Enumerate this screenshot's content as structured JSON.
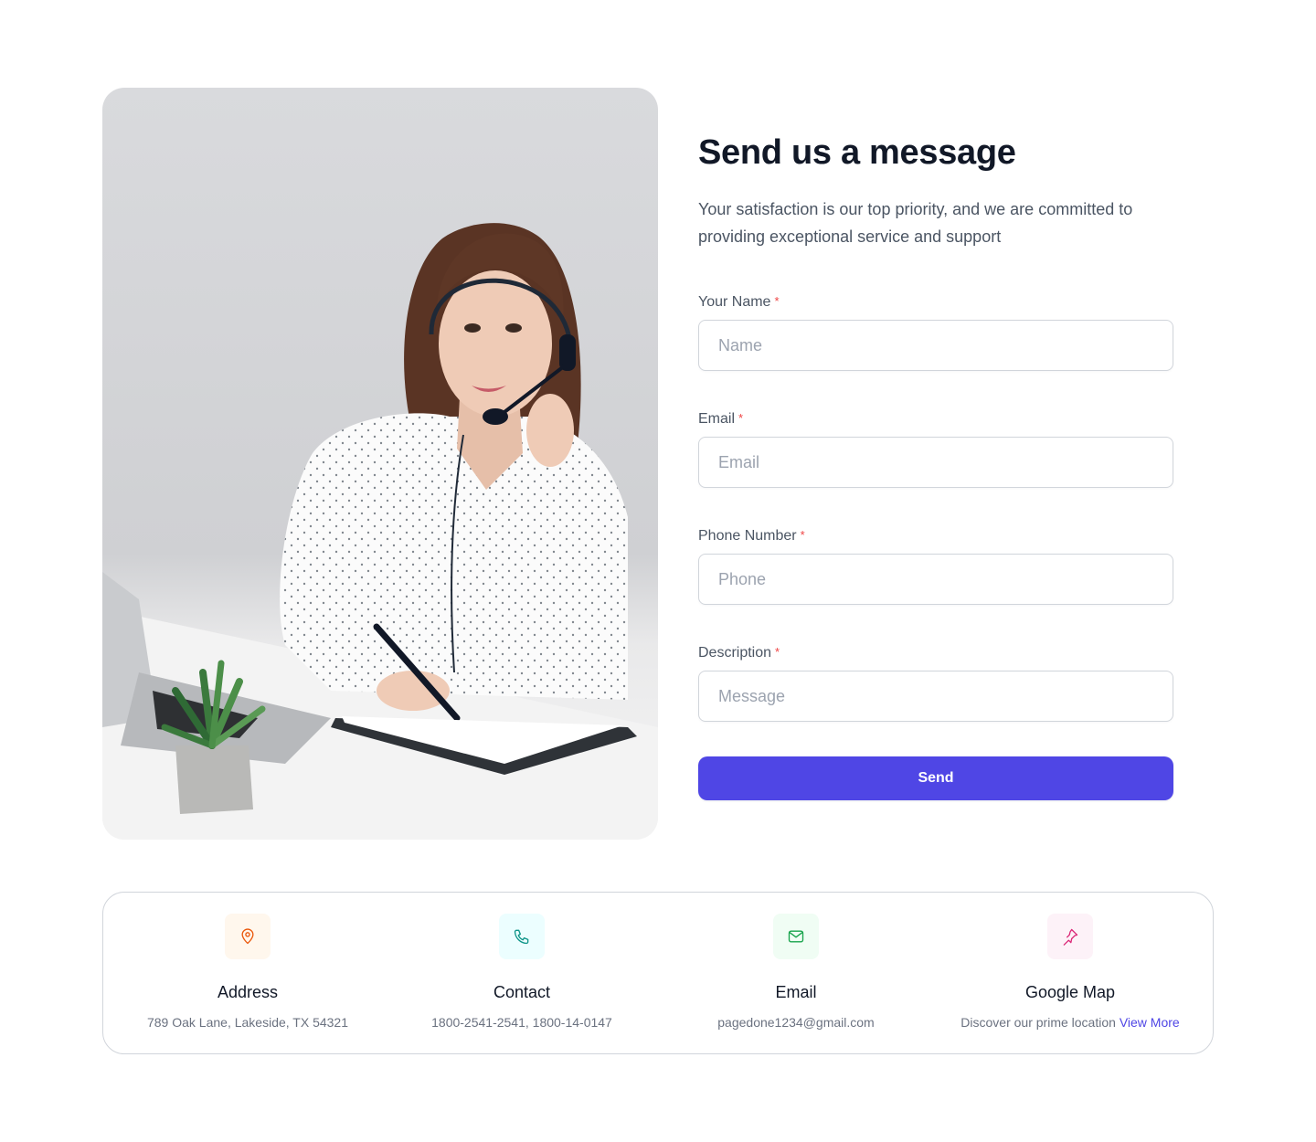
{
  "form": {
    "title": "Send us a message",
    "subtitle": "Your satisfaction is our top priority, and we are committed to providing exceptional service and support",
    "required_mark": "*",
    "fields": [
      {
        "label": "Your Name",
        "placeholder": "Name",
        "value": ""
      },
      {
        "label": "Email",
        "placeholder": "Email",
        "value": ""
      },
      {
        "label": "Phone Number",
        "placeholder": "Phone",
        "value": ""
      },
      {
        "label": "Description",
        "placeholder": "Message",
        "value": ""
      }
    ],
    "submit_label": "Send"
  },
  "contact_info": [
    {
      "icon": "map-pin-icon",
      "title": "Address",
      "text": "789 Oak Lane, Lakeside, TX 54321",
      "color": "#ea580c",
      "bg": "#fff7ed"
    },
    {
      "icon": "phone-icon",
      "title": "Contact",
      "text": "1800-2541-2541, 1800-14-0147",
      "color": "#0d9488",
      "bg": "#ecfeff"
    },
    {
      "icon": "mail-icon",
      "title": "Email",
      "text": "pagedone1234@gmail.com",
      "color": "#16a34a",
      "bg": "#f0fdf4"
    },
    {
      "icon": "pin-icon",
      "title": "Google Map",
      "text": "Discover our prime location",
      "link": "View More",
      "color": "#db2777",
      "bg": "#fdf2f8"
    }
  ],
  "colors": {
    "primary": "#4f46e5",
    "required": "#ef4444",
    "heading": "#111827",
    "body": "#4b5563"
  }
}
